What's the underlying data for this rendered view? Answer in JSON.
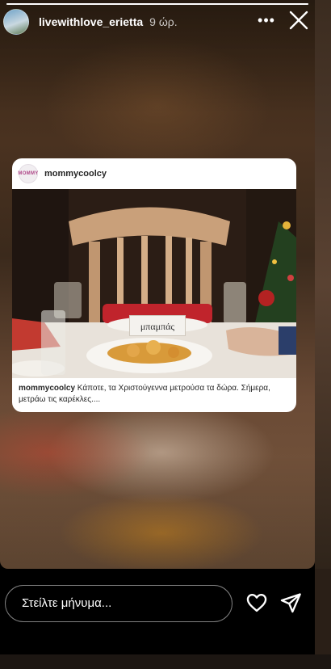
{
  "story": {
    "username": "livewithlove_erietta",
    "time": "9 ώρ.",
    "progress": 1.0,
    "more_icon": "more-dots-icon",
    "close_icon": "close-icon"
  },
  "shared_post": {
    "username": "mommycoolcy",
    "avatar_text": "MOMMY",
    "place_card_text": "μπαμπάς",
    "caption_user": "mommycoolcy",
    "caption_text": " Κάποτε, τα Χριστούγεννα μετρούσα τα δώρα. Σήμερα, μετράω τις καρέκλες...."
  },
  "reply_bar": {
    "placeholder": "Στείλτε μήνυμα...",
    "heart_icon": "heart-icon",
    "send_icon": "paper-plane-icon"
  }
}
